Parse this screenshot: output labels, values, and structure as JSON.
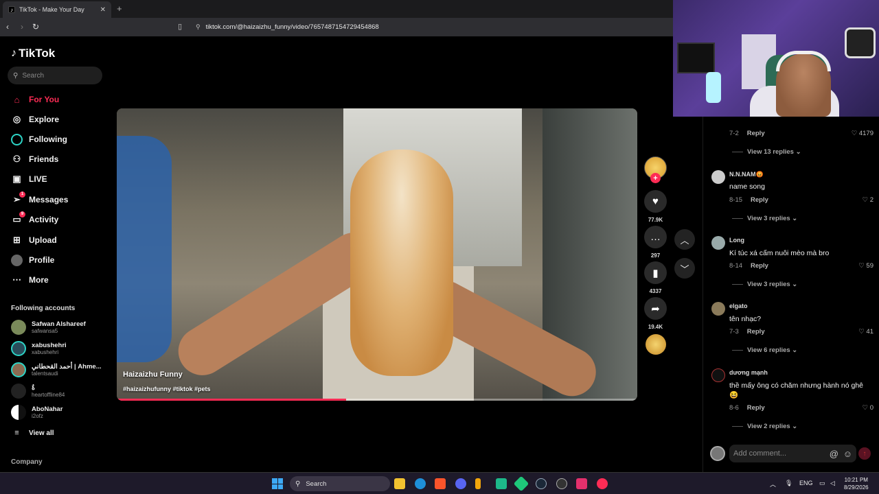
{
  "browser": {
    "tab_title": "TikTok - Make Your Day",
    "tab_close": "✕",
    "new_tab": "+",
    "url": "tiktok.com/@haizaizhu_funny/video/7657487154729454868"
  },
  "sidebar": {
    "logo": "TikTok",
    "search_placeholder": "Search",
    "nav": [
      {
        "label": "For You",
        "icon": "home-icon",
        "active": true
      },
      {
        "label": "Explore",
        "icon": "compass-icon"
      },
      {
        "label": "Following",
        "icon": "following-icon"
      },
      {
        "label": "Friends",
        "icon": "friends-icon"
      },
      {
        "label": "LIVE",
        "icon": "live-icon"
      },
      {
        "label": "Messages",
        "icon": "messages-icon",
        "badge": "1"
      },
      {
        "label": "Activity",
        "icon": "activity-icon",
        "badge": "9"
      },
      {
        "label": "Upload",
        "icon": "upload-icon"
      },
      {
        "label": "Profile",
        "icon": "profile-icon"
      },
      {
        "label": "More",
        "icon": "more-icon"
      }
    ],
    "following_title": "Following accounts",
    "accounts": [
      {
        "name": "Safwan Alshareef",
        "handle": "safwansa5"
      },
      {
        "name": "xabushehri",
        "handle": "xabushehri"
      },
      {
        "name": "أحمد القحطاني | Ahme...",
        "handle": "talentsaudi"
      },
      {
        "name": "ةُ",
        "handle": "heartoffline84"
      },
      {
        "name": "AboNahar",
        "handle": "i2ofz"
      }
    ],
    "view_all": "View all",
    "company": "Company"
  },
  "video": {
    "author": "Haizaizhu Funny",
    "tags": "#haizaizhufunny #tiktok #pets",
    "progress": 0.44
  },
  "actions": {
    "likes": "77.9K",
    "comments": "297",
    "saves": "4337",
    "shares": "19.4K"
  },
  "comments": {
    "top": {
      "date": "7-2",
      "reply": "Reply",
      "likes": "4179",
      "view_replies": "View 13 replies"
    },
    "items": [
      {
        "name": "N.N.NAM😡",
        "text": "name song",
        "date": "8-15",
        "reply": "Reply",
        "likes": "2",
        "view_replies": "View 3 replies"
      },
      {
        "name": "Long",
        "text": "Kí túc xá cấm nuôi mèo mà bro",
        "date": "8-14",
        "reply": "Reply",
        "likes": "59",
        "view_replies": "View 3 replies"
      },
      {
        "name": "elgato",
        "text": "tên nhạc?",
        "date": "7-3",
        "reply": "Reply",
        "likes": "41",
        "view_replies": "View 6 replies"
      },
      {
        "name": "dương mạnh",
        "text": "thề mấy ông có chăm nhưng hành nó ghê 😆",
        "date": "8-6",
        "reply": "Reply",
        "likes": "0",
        "view_replies": "View 2 replies"
      }
    ],
    "add_placeholder": "Add comment..."
  },
  "taskbar": {
    "search": "Search",
    "lang": "ENG",
    "time": "10:21 PM",
    "date": "8/29/2026"
  },
  "colors": {
    "accent": "#fe2c55",
    "background": "#000000"
  }
}
